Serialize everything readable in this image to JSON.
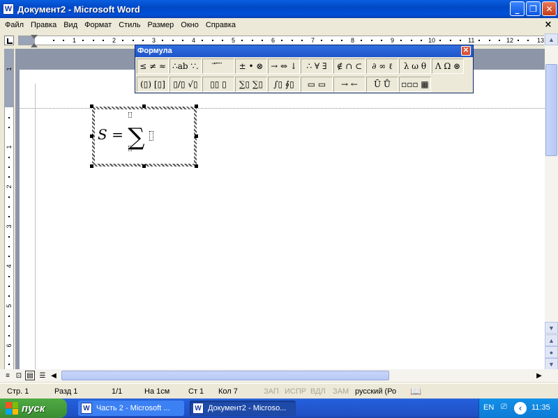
{
  "window": {
    "title": "Документ2 - Microsoft Word",
    "icon_letter": "W",
    "controls": {
      "minimize": "_",
      "maximize": "❐",
      "close": "✕"
    }
  },
  "menu": {
    "items": [
      "Файл",
      "Правка",
      "Вид",
      "Формат",
      "Стиль",
      "Размер",
      "Окно",
      "Справка"
    ],
    "close": "×"
  },
  "ruler": {
    "h_ticks": [
      "1",
      "2",
      "3",
      "4",
      "5",
      "6",
      "7",
      "8",
      "9",
      "10",
      "11",
      "12",
      "13"
    ],
    "v_ticks": [
      "1",
      "1",
      "2",
      "3",
      "4",
      "5",
      "6"
    ]
  },
  "formula": {
    "lhs": "S",
    "eq": "=",
    "sigma": "∑"
  },
  "formula_toolbar": {
    "title": "Формула",
    "close": "✕",
    "row1": [
      "≤ ≠ ≈",
      "∴ab ∵.",
      "⃗ ⃛ ⃜",
      "± • ⊗",
      "→ ⇔ ↓",
      "∴ ∀ ∃",
      "∉ ∩ ⊂",
      "∂ ∞ ℓ",
      "λ ω θ",
      "Λ Ω ⊛"
    ],
    "row2": [
      "(▯) [▯]",
      "▯/▯ √▯",
      "▯▯ ▯",
      "∑▯ ∑▯",
      "∫▯ ∮▯",
      "▭ ▭",
      "→ ←",
      "Ū Ů",
      "▫▫▫ ▦"
    ]
  },
  "status": {
    "page": "Стр. 1",
    "section": "Разд 1",
    "pages": "1/1",
    "position": "На 1см",
    "line": "Ст 1",
    "col": "Кол 7",
    "rec": "ЗАП",
    "trk": "ИСПР",
    "ext": "ВДЛ",
    "ovr": "ЗАМ",
    "lang": "русский (Ро"
  },
  "taskbar": {
    "start": "пуск",
    "tasks": [
      {
        "label": "Часть 2 - Microsoft ...",
        "active": false
      },
      {
        "label": "Документ2 - Microso...",
        "active": true
      }
    ],
    "lang": "EN",
    "time": "11:35"
  }
}
